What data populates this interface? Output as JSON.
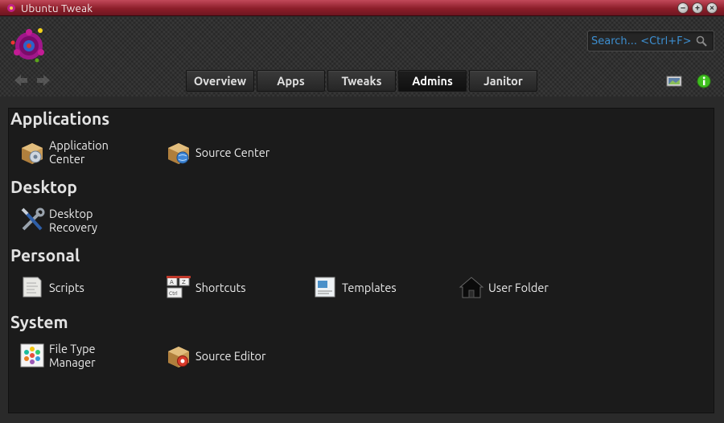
{
  "window": {
    "title": "Ubuntu Tweak",
    "buttons": [
      "minimize",
      "maximize",
      "close"
    ]
  },
  "search": {
    "placeholder": "Search... <Ctrl+F>"
  },
  "tabs": [
    {
      "label": "Overview",
      "active": false
    },
    {
      "label": "Apps",
      "active": false
    },
    {
      "label": "Tweaks",
      "active": false
    },
    {
      "label": "Admins",
      "active": true
    },
    {
      "label": "Janitor",
      "active": false
    }
  ],
  "sections": [
    {
      "title": "Applications",
      "items": [
        {
          "label": "Application Center",
          "icon": "package-gear-icon"
        },
        {
          "label": "Source Center",
          "icon": "package-globe-icon"
        }
      ]
    },
    {
      "title": "Desktop",
      "items": [
        {
          "label": "Desktop Recovery",
          "icon": "tools-icon"
        }
      ]
    },
    {
      "title": "Personal",
      "items": [
        {
          "label": "Scripts",
          "icon": "script-icon"
        },
        {
          "label": "Shortcuts",
          "icon": "keyboard-shortcut-icon"
        },
        {
          "label": "Templates",
          "icon": "template-icon"
        },
        {
          "label": "User Folder",
          "icon": "home-folder-icon"
        }
      ]
    },
    {
      "title": "System",
      "items": [
        {
          "label": "File Type Manager",
          "icon": "file-type-icon"
        },
        {
          "label": "Source Editor",
          "icon": "package-edit-icon"
        }
      ]
    }
  ],
  "colors": {
    "titlebar": "#8c1e2a",
    "search_text": "#3d8fd1",
    "info_green": "#3fbf1f"
  }
}
